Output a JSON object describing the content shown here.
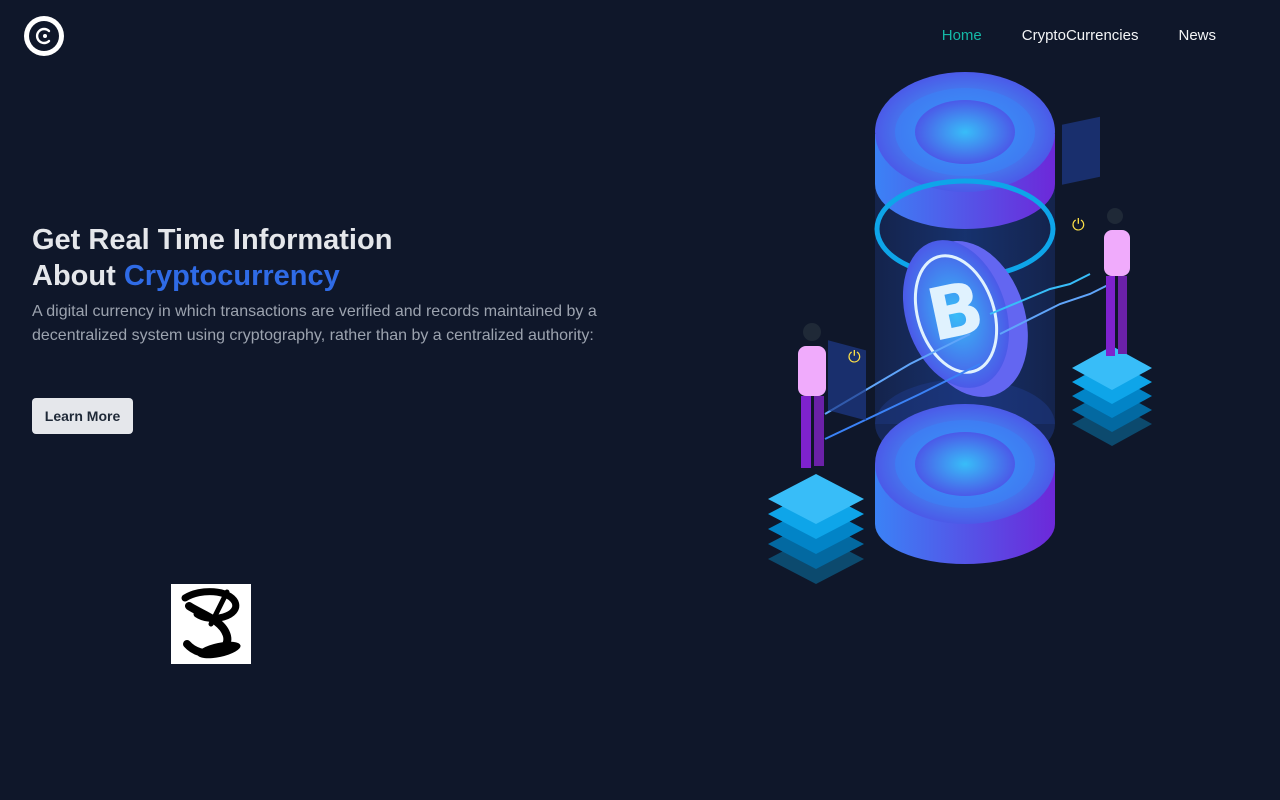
{
  "nav": {
    "items": [
      {
        "label": "Home",
        "active": true
      },
      {
        "label": "CryptoCurrencies",
        "active": false
      },
      {
        "label": "News",
        "active": false
      }
    ]
  },
  "hero": {
    "title_line1": "Get Real Time Information",
    "title_line2_prefix": "About ",
    "title_line2_accent": "Cryptocurrency",
    "description": "A digital currency in which transactions are verified and records maintained by a decentralized system using cryptography, rather than by a centralized authority:",
    "cta_label": "Learn More"
  },
  "icons": {
    "logo": "c-circle-logo-icon",
    "illustration": "bitcoin-illustration",
    "partner": "partner-logo"
  },
  "colors": {
    "background": "#0f172a",
    "accent": "#2f6be6",
    "nav_active": "#14b8a6",
    "button_bg": "#e5e7eb"
  }
}
